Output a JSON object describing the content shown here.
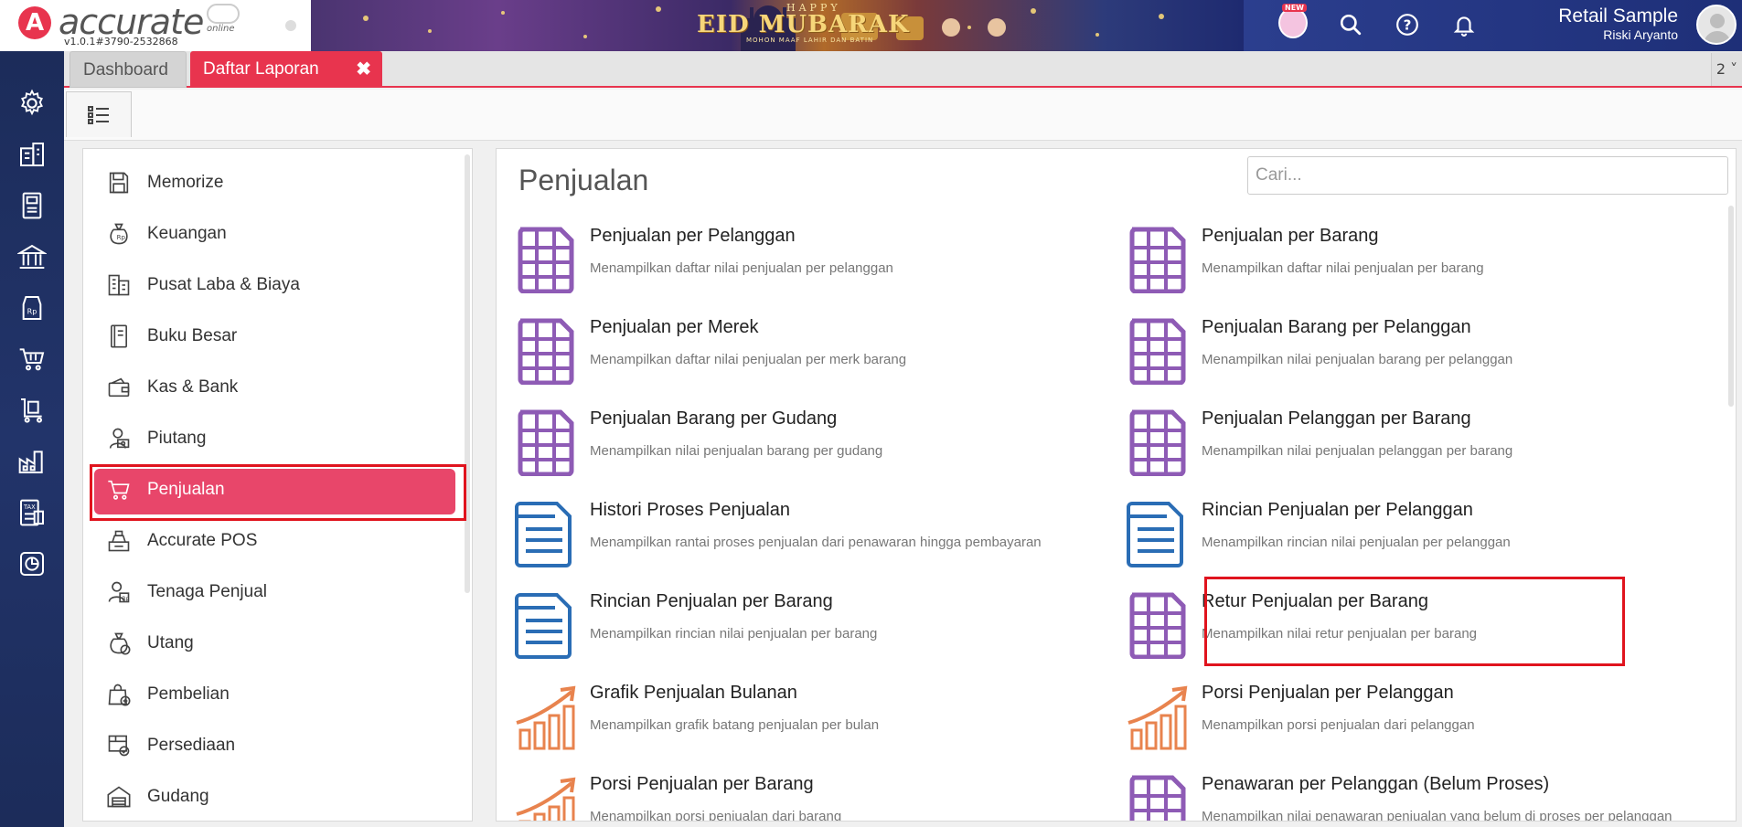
{
  "app": {
    "logo_letter": "A",
    "logo_text": "accurate",
    "logo_suffix": "online",
    "version": "v1.0.1#3790-2532868"
  },
  "banner": {
    "happy": "HAPPY",
    "title": "EID MUBARAK",
    "subtitle": "MOHON MAAF LAHIR DAN BATIN"
  },
  "header": {
    "new_label": "NEW",
    "company": "Retail Sample",
    "user": "Riski Aryanto"
  },
  "tabs": {
    "dashboard": "Dashboard",
    "laporan": "Daftar Laporan",
    "close": "✖",
    "more": "2 ˅"
  },
  "menu": {
    "items": [
      {
        "label": "Memorize",
        "icon": "save-icon"
      },
      {
        "label": "Keuangan",
        "icon": "money-bag-icon"
      },
      {
        "label": "Pusat Laba & Biaya",
        "icon": "building-icon"
      },
      {
        "label": "Buku Besar",
        "icon": "ledger-book-icon"
      },
      {
        "label": "Kas & Bank",
        "icon": "wallet-icon"
      },
      {
        "label": "Piutang",
        "icon": "receivable-icon"
      },
      {
        "label": "Penjualan",
        "icon": "cart-icon",
        "active": true
      },
      {
        "label": "Accurate POS",
        "icon": "cash-register-icon"
      },
      {
        "label": "Tenaga Penjual",
        "icon": "salesperson-icon"
      },
      {
        "label": "Utang",
        "icon": "payable-icon"
      },
      {
        "label": "Pembelian",
        "icon": "shopping-bag-icon"
      },
      {
        "label": "Persediaan",
        "icon": "inventory-icon"
      },
      {
        "label": "Gudang",
        "icon": "warehouse-icon"
      }
    ]
  },
  "reports": {
    "title": "Penjualan",
    "search_placeholder": "Cari...",
    "items": [
      {
        "title": "Penjualan per Pelanggan",
        "desc": "Menampilkan daftar nilai penjualan per pelanggan",
        "icon": "grid-report-icon"
      },
      {
        "title": "Penjualan per Barang",
        "desc": "Menampilkan daftar nilai penjualan per barang",
        "icon": "grid-report-icon"
      },
      {
        "title": "Penjualan per Merek",
        "desc": "Menampilkan daftar nilai penjualan per merk barang",
        "icon": "grid-report-icon"
      },
      {
        "title": "Penjualan Barang per Pelanggan",
        "desc": "Menampilkan nilai penjualan barang per pelanggan",
        "icon": "grid-report-icon"
      },
      {
        "title": "Penjualan Barang per Gudang",
        "desc": "Menampilkan nilai penjualan barang per gudang",
        "icon": "grid-report-icon"
      },
      {
        "title": "Penjualan Pelanggan per Barang",
        "desc": "Menampilkan nilai penjualan pelanggan per barang",
        "icon": "grid-report-icon"
      },
      {
        "title": "Histori Proses Penjualan",
        "desc": "Menampilkan rantai proses penjualan dari penawaran hingga pembayaran",
        "icon": "document-report-icon"
      },
      {
        "title": "Rincian Penjualan per Pelanggan",
        "desc": "Menampilkan rincian nilai penjualan per pelanggan",
        "icon": "document-report-icon"
      },
      {
        "title": "Rincian Penjualan per Barang",
        "desc": "Menampilkan rincian nilai penjualan per barang",
        "icon": "document-report-icon"
      },
      {
        "title": "Retur Penjualan per Barang",
        "desc": "Menampilkan nilai retur penjualan per barang",
        "icon": "grid-report-icon"
      },
      {
        "title": "Grafik Penjualan Bulanan",
        "desc": "Menampilkan grafik batang penjualan per bulan",
        "icon": "chart-report-icon"
      },
      {
        "title": "Porsi Penjualan per Pelanggan",
        "desc": "Menampilkan porsi penjualan dari pelanggan",
        "icon": "chart-report-icon"
      },
      {
        "title": "Porsi Penjualan per Barang",
        "desc": "Menampilkan porsi penjualan dari barang",
        "icon": "chart-report-icon"
      },
      {
        "title": "Penawaran per Pelanggan (Belum Proses)",
        "desc": "Menampilkan nilai penawaran penjualan yang belum di proses per pelanggan",
        "icon": "grid-report-icon"
      }
    ]
  },
  "colors": {
    "accent": "#e8344e",
    "active_menu": "#e8466a",
    "highlight": "#e0141e",
    "grid_icon": "#8e5bb5",
    "doc_icon": "#2a6db5",
    "chart_icon": "#e8834e",
    "sidebar": "#1c2c5a"
  }
}
